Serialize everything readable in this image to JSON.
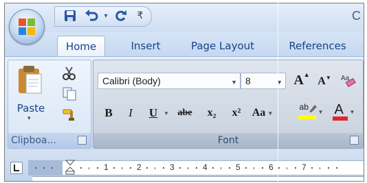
{
  "title_partial": "C",
  "quick_access": {
    "icons": [
      "save-icon",
      "undo-icon",
      "redo-icon",
      "customize-icon"
    ]
  },
  "tabs": [
    {
      "label": "Home",
      "active": true
    },
    {
      "label": "Insert",
      "active": false
    },
    {
      "label": "Page Layout",
      "active": false
    },
    {
      "label": "References",
      "active": false
    }
  ],
  "clipboard": {
    "paste_label": "Paste",
    "group_label": "Clipboa..."
  },
  "font": {
    "font_name": "Calibri (Body)",
    "font_size": "8",
    "group_label": "Font",
    "bold": "B",
    "italic": "I",
    "underline": "U",
    "strikethrough": "abe",
    "subscript": "x₂",
    "superscript": "x²",
    "change_case": "Aa",
    "grow_font": "A",
    "shrink_font": "A",
    "font_color": "A",
    "highlight": "ab"
  },
  "ruler": {
    "numbers": [
      "1",
      "2",
      "3",
      "4",
      "5",
      "6",
      "7"
    ]
  },
  "colors": {
    "tab_text": "#15428b",
    "font_color_bar": "#e0262a",
    "highlight_bar": "#ffff00"
  }
}
